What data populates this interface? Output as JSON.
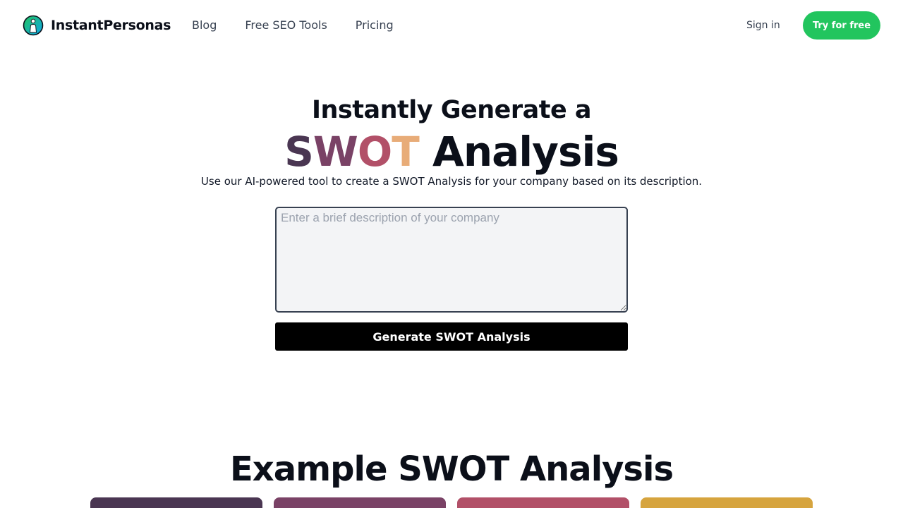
{
  "header": {
    "brand": "InstantPersonas",
    "nav": [
      "Blog",
      "Free SEO Tools",
      "Pricing"
    ],
    "sign_in": "Sign in",
    "try_free": "Try for free"
  },
  "hero": {
    "line1": "Instantly Generate a",
    "swot_letters": [
      {
        "char": "S",
        "color": "#4a3652"
      },
      {
        "char": "W",
        "color": "#7a4266"
      },
      {
        "char": "O",
        "color": "#b25068"
      },
      {
        "char": "T",
        "color": "#e8ac78"
      }
    ],
    "line2_rest": " Analysis",
    "subtitle": "Use our AI-powered tool to create a SWOT Analysis for your company based on its description."
  },
  "form": {
    "placeholder": "Enter a brief description of your company",
    "button": "Generate SWOT Analysis"
  },
  "example": {
    "title": "Example SWOT Analysis",
    "card_colors": [
      "#4a3652",
      "#7a4266",
      "#b25068",
      "#d6a43e"
    ]
  },
  "colors": {
    "accent_green": "#22c55e",
    "text_dark": "#0b0f19"
  }
}
